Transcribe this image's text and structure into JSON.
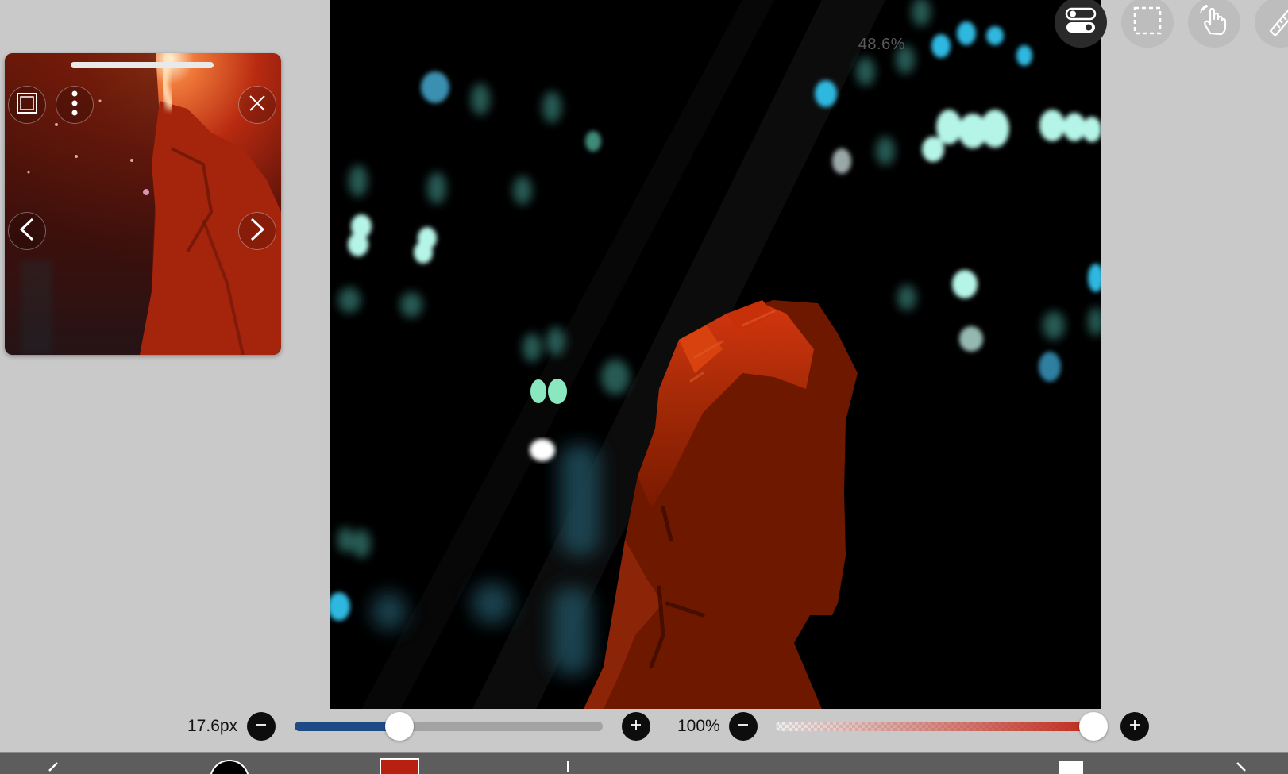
{
  "canvas": {
    "zoom_label": "48.6%",
    "subject_color": "#7a1a00",
    "bokeh_color": "#4fd8f0"
  },
  "reference_window": {
    "icons": [
      "square-icon",
      "more-vertical-icon",
      "close-icon",
      "chevron-left-icon",
      "chevron-right-icon"
    ]
  },
  "toolbar_top": {
    "icons": [
      "toggle-icon",
      "selection-icon",
      "hand-icon",
      "ruler-icon"
    ]
  },
  "brush": {
    "size_label": "17.6px",
    "size_fraction": 0.34,
    "opacity_label": "100%",
    "opacity_fraction": 1.0,
    "size_track_color": "#1e4a86",
    "opacity_track_color": "#c0281a"
  },
  "bottom_bar": {
    "current_color": "#b8200f",
    "icons": [
      "undo-icon",
      "color-circle-icon",
      "color-swatch-icon",
      "layer-icon",
      "redo-icon"
    ]
  }
}
